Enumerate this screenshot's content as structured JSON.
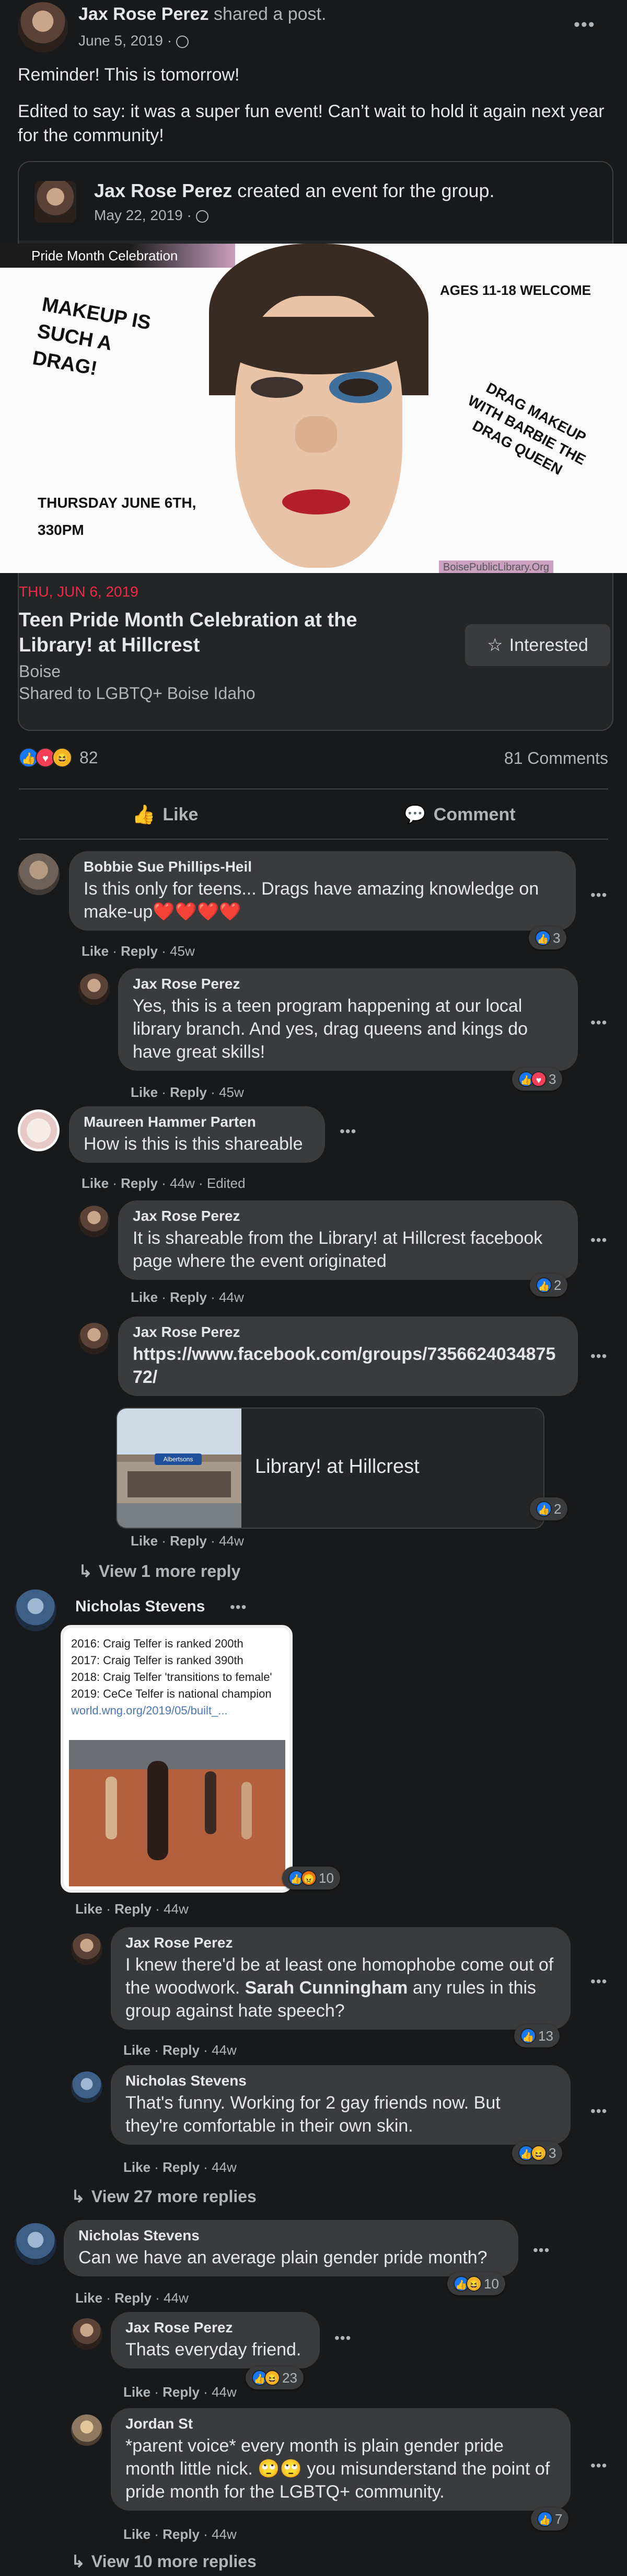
{
  "post": {
    "author": "Jax Rose Perez",
    "action": "shared a post.",
    "date": "June 5, 2019",
    "line1": "Reminder! This is tomorrow!",
    "line2": "Edited to say: it was a super fun event! Can’t wait to hold it again next year for the community!"
  },
  "shared": {
    "author": "Jax Rose Perez",
    "action": "created an event for the group.",
    "date": "May 22, 2019"
  },
  "event_image": {
    "banner": "Pride Month Celebration",
    "left_text": "MAKEUP IS SUCH A DRAG!",
    "ages": "AGES 11-18 WELCOME",
    "right_text": "DRAG MAKEUP WITH BARBIE THE DRAG QUEEN",
    "date_text": "THURSDAY JUNE 6TH, 330PM",
    "footer_text": "BoisePublicLibrary.Org"
  },
  "event": {
    "date": "THU, JUN 6, 2019",
    "title": "Teen Pride Month Celebration at the Library! at Hillcrest",
    "location": "Boise",
    "shared_to": "Shared to LGBTQ+ Boise Idaho",
    "interested": "Interested"
  },
  "stats": {
    "reactions": "82",
    "comments": "81 Comments"
  },
  "bar": {
    "like": "Like",
    "comment": "Comment"
  },
  "comments": {
    "c1": {
      "name": "Bobbie Sue Phillips-Heil",
      "text": "Is this only for teens... Drags have amazing knowledge on make-up❤️❤️❤️❤️",
      "meta": "45w",
      "count": "3"
    },
    "r1": {
      "name": "Jax Rose Perez",
      "text": "Yes, this is a teen program happening at our local library branch. And yes, drag queens and kings do have great skills!",
      "meta": "45w",
      "count": "3"
    },
    "c2": {
      "name": "Maureen Hammer Parten",
      "text": "How is this is this shareable",
      "meta": "44w · Edited"
    },
    "r2": {
      "name": "Jax Rose Perez",
      "text": "It is shareable from the Library! at Hillcrest facebook page where the event originated",
      "meta": "44w",
      "count": "2"
    },
    "r3": {
      "name": "Jax Rose Perez",
      "link": "https://www.facebook.com/groups/735662403487572/",
      "meta": "44w",
      "count": "2",
      "card_title": "Library! at Hillcrest",
      "store_sign": "Albertsons"
    },
    "view_more_1": "View 1 more reply",
    "c3": {
      "name": "Nicholas Stevens",
      "meta": "44w",
      "count": "10",
      "img_lines": [
        "2016: Craig Telfer is ranked 200th",
        "2017: Craig Telfer is ranked 390th",
        "2018: Craig Telfer 'transitions to female'",
        "2019: CeCe Telfer is national champion"
      ],
      "img_url": "world.wng.org/2019/05/built_..."
    },
    "r4": {
      "name": "Jax Rose Perez",
      "text_a": "I knew there'd be at least one homophobe come out of the woodwork. ",
      "text_tag": "Sarah Cunningham",
      "text_b": " any rules in this group against hate speech?",
      "meta": "44w",
      "count": "13"
    },
    "r5": {
      "name": "Nicholas Stevens",
      "text": "That's funny. Working for 2 gay friends now. But they're comfortable in their own skin.",
      "meta": "44w",
      "count": "3"
    },
    "view_more_27": "View 27 more replies",
    "c4": {
      "name": "Nicholas Stevens",
      "text": "Can we have an average plain gender pride month?",
      "meta": "44w",
      "count": "10"
    },
    "r6": {
      "name": "Jax Rose Perez",
      "text": "Thats everyday friend.",
      "meta": "44w",
      "count": "23"
    },
    "r7": {
      "name": "Jordan St",
      "text": "*parent voice* every month is plain gender pride month little nick. 🙄🙄 you misunderstand the point of pride month for the LGBTQ+ community.",
      "meta": "44w",
      "count": "7"
    },
    "view_more_10": "View 10 more replies"
  },
  "labels": {
    "like": "Like",
    "reply": "Reply",
    "sep": "·"
  },
  "colors": {
    "accent": "#1877f2",
    "bg": "#18191a",
    "bubble": "#3a3b3c",
    "event_date": "#f02849"
  }
}
